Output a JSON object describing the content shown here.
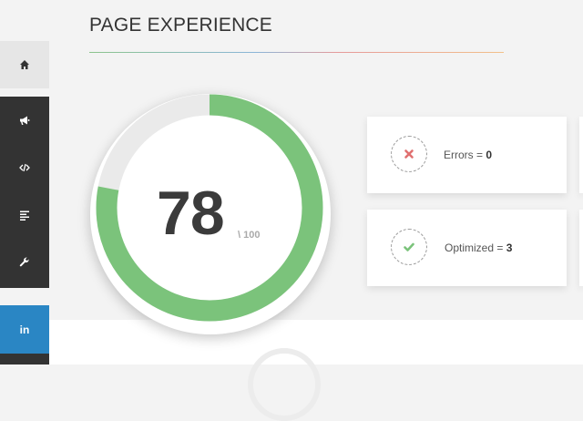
{
  "header": {
    "title": "PAGE EXPERIENCE"
  },
  "sidebar": {
    "items": [
      {
        "icon": "home-icon"
      },
      {
        "icon": "megaphone-icon"
      },
      {
        "icon": "code-icon"
      },
      {
        "icon": "align-left-icon"
      },
      {
        "icon": "wrench-icon"
      },
      {
        "icon": "linkedin-icon",
        "label": "in"
      }
    ]
  },
  "score": {
    "value": "78",
    "max_label": "\\ 100",
    "fraction": 0.78
  },
  "cards": [
    {
      "label": "Errors = ",
      "value": "0",
      "icon": "x-icon"
    },
    {
      "label": "Optimized = ",
      "value": "3",
      "icon": "check-icon"
    }
  ],
  "colors": {
    "gauge_fill": "#7bc37b",
    "gauge_track": "#eaeaea",
    "error_icon": "#e07070",
    "success_icon": "#7bc37b",
    "linkedin": "#2a86c4",
    "sidebar_dark": "#333333"
  }
}
